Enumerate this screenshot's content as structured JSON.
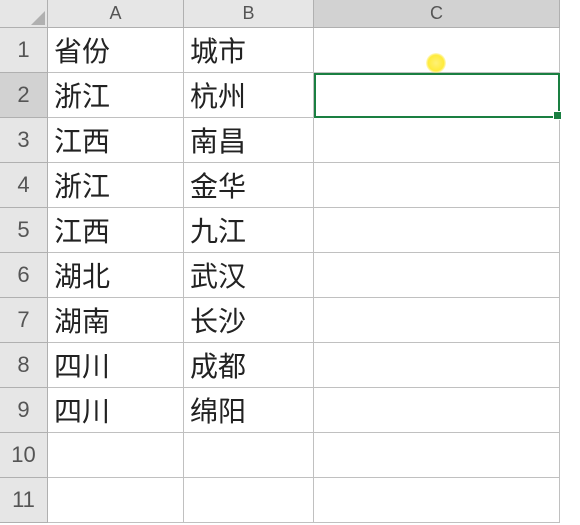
{
  "columns": [
    "A",
    "B",
    "C"
  ],
  "rowCount": 11,
  "activeCell": {
    "row": 2,
    "col": "C"
  },
  "cells": {
    "A1": "省份",
    "B1": "城市",
    "A2": "浙江",
    "B2": "杭州",
    "A3": "江西",
    "B3": "南昌",
    "A4": "浙江",
    "B4": "金华",
    "A5": "江西",
    "B5": "九江",
    "A6": "湖北",
    "B6": "武汉",
    "A7": "湖南",
    "B7": "长沙",
    "A8": "四川",
    "B8": "成都",
    "A9": "四川",
    "B9": "绵阳"
  },
  "cursor": {
    "icon": "plus",
    "highlight": true
  }
}
